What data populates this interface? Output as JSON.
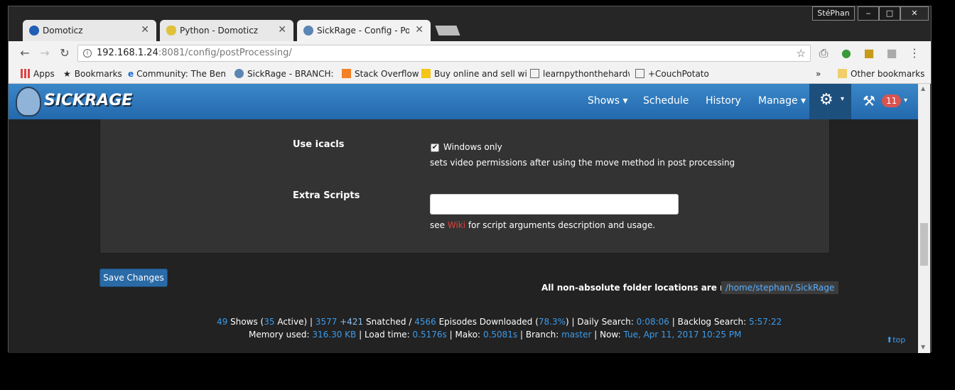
{
  "browser": {
    "profile_name": "StéPhan",
    "tabs": [
      {
        "label": "Domoticz"
      },
      {
        "label": "Python - Domoticz"
      },
      {
        "label": "SickRage - Config - Post"
      }
    ],
    "url_host": "192.168.1.24",
    "url_rest": ":8081/config/postProcessing/",
    "bookmarks": [
      {
        "label": "Apps"
      },
      {
        "label": "Bookmarks"
      },
      {
        "label": "Community: The Ben"
      },
      {
        "label": "SickRage - BRANCH:"
      },
      {
        "label": "Stack Overflow"
      },
      {
        "label": "Buy online and sell wi"
      },
      {
        "label": "learnpythonthehardw"
      },
      {
        "label": "+CouchPotato"
      }
    ],
    "other_bookmarks": "Other bookmarks"
  },
  "nav": {
    "logo": "SICKRAGE",
    "items": [
      {
        "label": "Shows ▾"
      },
      {
        "label": "Schedule"
      },
      {
        "label": "History"
      },
      {
        "label": "Manage ▾"
      }
    ],
    "notification_count": "11"
  },
  "settings": {
    "icacls_label": "Use icacls",
    "icacls_checkbox_text": "Windows only",
    "icacls_checked": true,
    "icacls_help": "sets video permissions after using the move method in post processing",
    "extra_scripts_label": "Extra Scripts",
    "extra_scripts_value": "",
    "extra_help_prefix": "see",
    "extra_help_link": "Wiki",
    "extra_help_suffix": "for script arguments description and usage."
  },
  "actions": {
    "save_label": "Save Changes",
    "relative_note": "All non-absolute folder locations are relative to",
    "relative_path": "/home/stephan/.SickRage"
  },
  "footer": {
    "shows": "49",
    "shows_label": "Shows (",
    "active": "35",
    "active_label": "Active)",
    "snatched": "3577",
    "snatched_plus": "+421",
    "snatched_label": "Snatched /",
    "downloaded": "4566",
    "downloaded_label": "Episodes Downloaded (",
    "pct": "78.3%",
    "daily_label": ") | Daily Search:",
    "daily": "0:08:06",
    "backlog_label": "| Backlog Search:",
    "backlog": "5:57:22",
    "memory_label": "Memory used:",
    "memory": "316.30 KB",
    "load_label": "| Load time:",
    "load": "0.5176s",
    "mako_label": "| Mako:",
    "mako": "0.5081s",
    "branch_label": "| Branch:",
    "branch": "master",
    "now_label": "| Now:",
    "now": "Tue, Apr 11, 2017 10:25 PM",
    "top": "top"
  },
  "colors": {
    "accent": "#2a6aa6",
    "link": "#3d9bea",
    "wiki": "#e0413a",
    "badge": "#d9534f"
  }
}
